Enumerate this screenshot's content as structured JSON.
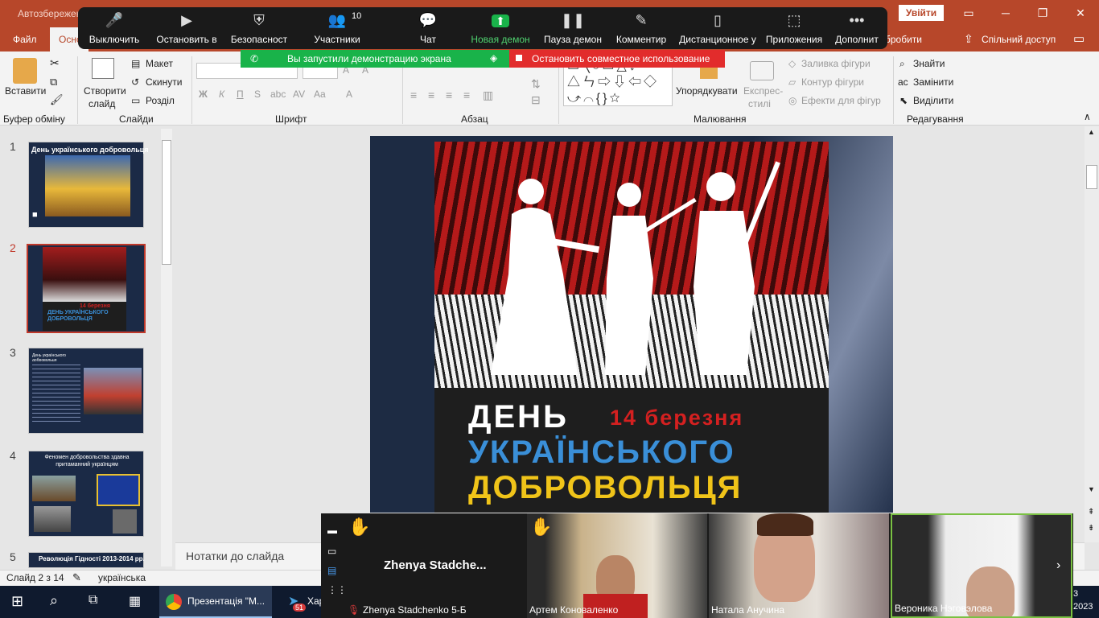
{
  "window": {
    "title": "Автозбереження",
    "signin": "Увійти"
  },
  "tabs": {
    "file": "Файл",
    "home": "Осно",
    "share": "Спільний доступ",
    "prev": "бробити"
  },
  "zoom": {
    "items": [
      {
        "label": "Выключить",
        "icon": "mic-icon"
      },
      {
        "label": "Остановить в",
        "icon": "camera-icon"
      },
      {
        "label": "Безопасност",
        "icon": "shield-icon"
      },
      {
        "label": "Участники",
        "icon": "participants-icon",
        "count": "10"
      },
      {
        "label": "Чат",
        "icon": "chat-icon"
      },
      {
        "label": "Новая демон",
        "icon": "share-screen-icon"
      },
      {
        "label": "Пауза демон",
        "icon": "pause-icon"
      },
      {
        "label": "Комментир",
        "icon": "pen-icon"
      },
      {
        "label": "Дистанционное у",
        "icon": "mouse-icon"
      },
      {
        "label": "Приложения",
        "icon": "apps-icon"
      },
      {
        "label": "Дополнит",
        "icon": "more-icon"
      }
    ],
    "share_notice": "Вы запустили демонстрацию экрана",
    "stop_share": "Остановить совместное использование"
  },
  "ribbon": {
    "clipboard": {
      "paste": "Вставити",
      "label": "Буфер обміну"
    },
    "slides": {
      "new_slide_1": "Створити",
      "new_slide_2": "слайд",
      "layout": "Макет",
      "reset": "Скинути",
      "section": "Розділ",
      "label": "Слайди"
    },
    "font": {
      "bold": "Ж",
      "italic": "К",
      "underline": "П",
      "label": "Шрифт"
    },
    "paragraph": {
      "label": "Абзац"
    },
    "drawing": {
      "arrange": "Упорядкувати",
      "styles_1": "Експрес-",
      "styles_2": "стилі",
      "fill": "Заливка фігури",
      "outline": "Контур фігури",
      "effects": "Ефекти для фігур",
      "label": "Малювання"
    },
    "editing": {
      "find": "Знайти",
      "replace": "Замінити",
      "select": "Виділити",
      "label": "Редагування"
    }
  },
  "thumbnails": [
    {
      "num": "1",
      "title": "День українського добровольця"
    },
    {
      "num": "2",
      "title": "ДЕНЬ УКРАЇНСЬКОГО ДОБРОВОЛЬЦЯ",
      "date": "14 березня"
    },
    {
      "num": "3",
      "title": "День українського добровольця"
    },
    {
      "num": "4",
      "title": "Феномен добровольства здавна притаманний українцям"
    },
    {
      "num": "5",
      "title": "Революція Гідності 2013-2014 рр."
    }
  ],
  "slide": {
    "line1": "ДЕНЬ",
    "date": "14 березня",
    "line2": "УКРАЇНСЬКОГО",
    "line3": "ДОБРОВОЛЬЦЯ"
  },
  "notes": "Нотатки до слайда",
  "status": {
    "slide": "Слайд 2 з 14",
    "lang": "українська"
  },
  "taskbar": {
    "app": "Презентація \"М...",
    "app2": "Хар",
    "badge": "51",
    "clock1": "3",
    "clock2": "2023"
  },
  "video": {
    "tiles": [
      {
        "name": "Zhenya Stadchenko 5-Б",
        "big": "Zhenya  Stadche..."
      },
      {
        "name": "Артем Коноваленко"
      },
      {
        "name": "Натала Анучина"
      },
      {
        "name": "Вероника Нэговэлова"
      }
    ]
  }
}
